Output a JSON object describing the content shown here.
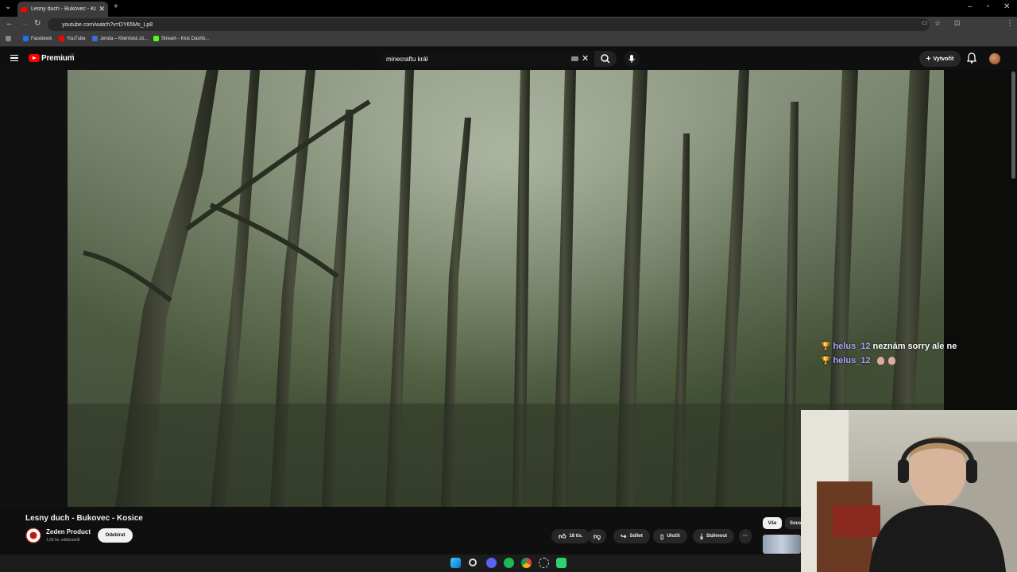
{
  "browser": {
    "tab_title": "Lesny duch - Bukovec - Kosice",
    "tab_close": "✕",
    "new_tab": "+",
    "url": "youtube.com/watch?v=DY65Ms_Lp8",
    "window_controls": {
      "minimize": "–",
      "maximize": "▫",
      "close": "✕"
    },
    "bookmarks": [
      {
        "label": "Facebook",
        "color": "#1877f2"
      },
      {
        "label": "YouTube",
        "color": "#ff0000"
      },
      {
        "label": "Jenda – Klientská zó...",
        "color": "#3a6fd8"
      },
      {
        "label": "Stream - Kick Dashb...",
        "color": "#53fc18"
      }
    ]
  },
  "youtube": {
    "logo_text": "Premium",
    "logo_country": "CZ",
    "search_value": "minecraftu král",
    "create_label": "Vytvořit"
  },
  "chat": [
    {
      "badge": "🏆",
      "user": "helus_12",
      "message": "neznám sorry ale ne"
    },
    {
      "badge": "🏆",
      "user": "helus_12",
      "message": ""
    }
  ],
  "video": {
    "title": "Lesny duch - Bukovec - Kosice",
    "channel": "Zeden Product",
    "subscribers": "1,95 tis. odběratelů",
    "subscribe_label": "Odebírat",
    "likes": "18 tis.",
    "share_label": "Sdílet",
    "save_label": "Uložit",
    "download_label": "Stáhnout",
    "more_label": "···"
  },
  "sidebar_chips": {
    "all": "Vše",
    "related": "Souv"
  },
  "colors": {
    "accent": "#ff0000",
    "chat_username": "#a9a5ff",
    "background": "#0f0f0f"
  }
}
